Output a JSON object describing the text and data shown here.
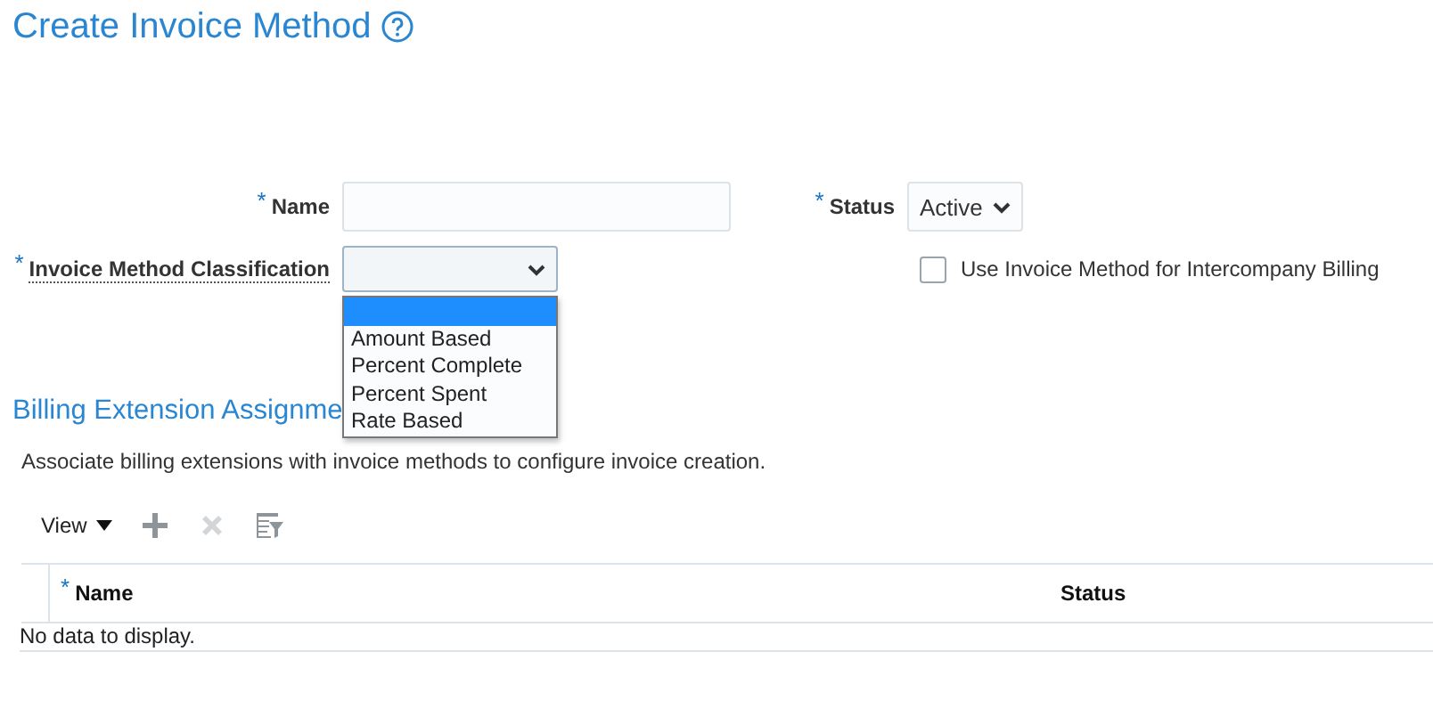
{
  "page": {
    "title": "Create Invoice Method"
  },
  "form": {
    "name": {
      "label": "Name",
      "required_mark": "*"
    },
    "status": {
      "label": "Status",
      "required_mark": "*",
      "value": "Active"
    },
    "classification": {
      "label": "Invoice Method Classification",
      "required_mark": "*",
      "expanded": true,
      "options": [
        {
          "selected": true
        },
        {
          "label": "Amount Based",
          "selected": false
        },
        {
          "label": "Percent Complete",
          "selected": false
        },
        {
          "label": "Percent Spent",
          "selected": false
        },
        {
          "label": "Rate Based",
          "selected": false
        }
      ]
    },
    "intercompany": {
      "label": "Use Invoice Method for Intercompany Billing",
      "checked": false
    }
  },
  "billing_section": {
    "title": "Billing Extension Assignme",
    "description": "Associate billing extensions with invoice methods to configure invoice creation.",
    "toolbar": {
      "view_label": "View",
      "actions": [
        {
          "kind": "add",
          "disabled": false
        },
        {
          "kind": "delete",
          "disabled": true
        },
        {
          "kind": "filter",
          "disabled": false
        }
      ]
    },
    "table": {
      "columns": [
        {
          "label": "Name",
          "required_mark": "*"
        },
        {
          "label": "Status"
        }
      ],
      "empty_message": "No data to display."
    }
  }
}
